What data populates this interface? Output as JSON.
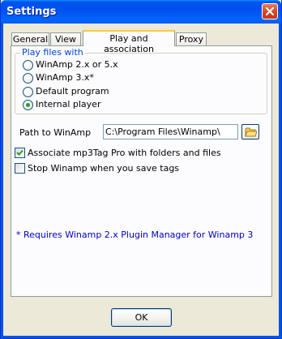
{
  "window": {
    "title": "Settings"
  },
  "tabs": [
    {
      "label": "General"
    },
    {
      "label": "View"
    },
    {
      "label": "Play and association",
      "active": true
    },
    {
      "label": "Proxy"
    }
  ],
  "play_files": {
    "group_title": "Play files with",
    "options": [
      {
        "label": "WinAmp 2.x or 5.x",
        "checked": false
      },
      {
        "label": "WinAmp 3.x*",
        "checked": false
      },
      {
        "label": "Default program",
        "checked": false
      },
      {
        "label": "Internal player",
        "checked": true
      }
    ]
  },
  "path": {
    "label": "Path to WinAmp",
    "value": "C:\\Program Files\\Winamp\\"
  },
  "options": {
    "associate_label": "Associate mp3Tag Pro with folders and files",
    "associate_checked": true,
    "stop_label": "Stop Winamp when you save tags",
    "stop_checked": false
  },
  "note": "* Requires Winamp 2.x Plugin Manager for Winamp 3",
  "buttons": {
    "ok_label": "OK"
  },
  "colors": {
    "accent_blue": "#0046d5",
    "note_blue": "#0000c0",
    "title_bar": "#0054e3",
    "active_tab_highlight": "#ffc83c"
  }
}
